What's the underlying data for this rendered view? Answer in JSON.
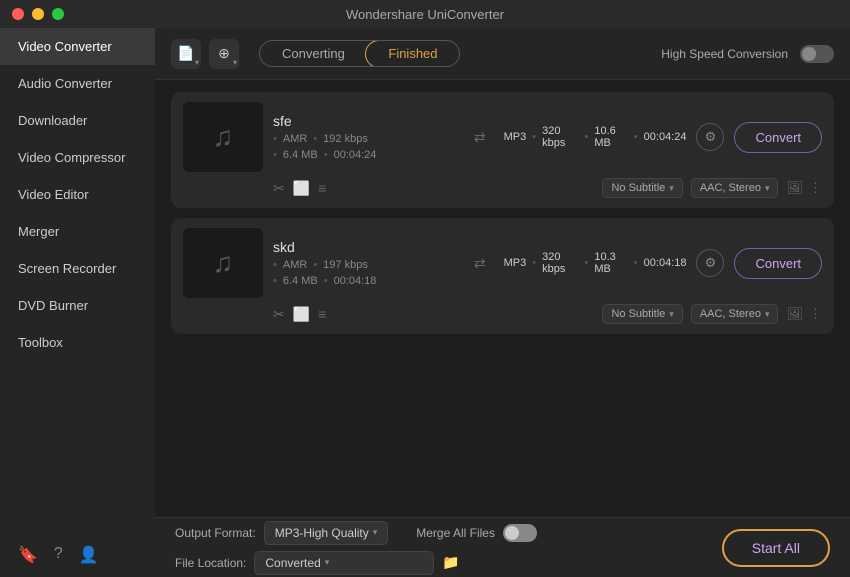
{
  "titlebar": {
    "title": "Wondershare UniConverter"
  },
  "sidebar": {
    "items": [
      {
        "label": "Video Converter",
        "active": true
      },
      {
        "label": "Audio Converter",
        "active": false
      },
      {
        "label": "Downloader",
        "active": false
      },
      {
        "label": "Video Compressor",
        "active": false
      },
      {
        "label": "Video Editor",
        "active": false
      },
      {
        "label": "Merger",
        "active": false
      },
      {
        "label": "Screen Recorder",
        "active": false
      },
      {
        "label": "DVD Burner",
        "active": false
      },
      {
        "label": "Toolbox",
        "active": false
      }
    ]
  },
  "topbar": {
    "add_file_icon": "📄",
    "add_icon": "➕",
    "tab_converting": "Converting",
    "tab_finished": "Finished",
    "high_speed_label": "High Speed Conversion"
  },
  "files": [
    {
      "name": "sfe",
      "src_format": "AMR",
      "src_bitrate": "192 kbps",
      "src_size": "6.4 MB",
      "src_duration": "00:04:24",
      "out_format": "MP3",
      "out_bitrate": "320 kbps",
      "out_size": "10.6 MB",
      "out_duration": "00:04:24",
      "subtitle": "No Subtitle",
      "audio": "AAC, Stereo",
      "convert_label": "Convert"
    },
    {
      "name": "skd",
      "src_format": "AMR",
      "src_bitrate": "197 kbps",
      "src_size": "6.4 MB",
      "src_duration": "00:04:18",
      "out_format": "MP3",
      "out_bitrate": "320 kbps",
      "out_size": "10.3 MB",
      "out_duration": "00:04:18",
      "subtitle": "No Subtitle",
      "audio": "AAC, Stereo",
      "convert_label": "Convert"
    }
  ],
  "bottombar": {
    "output_format_label": "Output Format:",
    "output_format_value": "MP3-High Quality",
    "merge_label": "Merge All Files",
    "file_location_label": "File Location:",
    "file_location_value": "Converted",
    "start_all_label": "Start All"
  }
}
